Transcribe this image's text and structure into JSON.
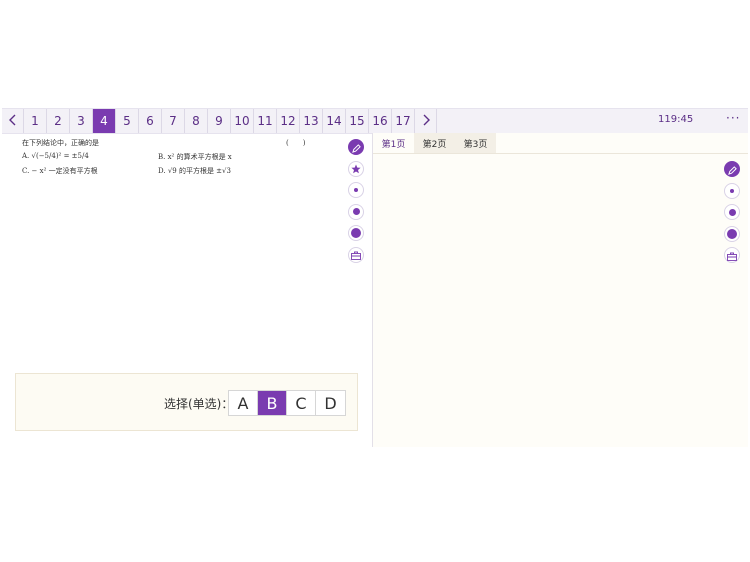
{
  "nav": {
    "prev_label": "<",
    "next_label": ">",
    "questions": [
      "1",
      "2",
      "3",
      "4",
      "5",
      "6",
      "7",
      "8",
      "9",
      "10",
      "11",
      "12",
      "13",
      "14",
      "15",
      "16",
      "17"
    ],
    "active_index": 3,
    "timer": "119:45",
    "more_label": "···"
  },
  "question": {
    "stem": "在下列结论中，正确的是",
    "paren": "(　　)",
    "option_a": "A. √(−5/4)² = ±5/4",
    "option_b": "B. x² 的算术平方根是 x",
    "option_c": "C. − x² 一定没有平方根",
    "option_d": "D. √9 的平方根是 ±√3"
  },
  "tools_left": [
    "pen-icon",
    "star-icon",
    "dot-small-icon",
    "dot-medium-icon",
    "dot-large-icon",
    "toolbox-icon"
  ],
  "tools_right": [
    "pen-icon",
    "dot-small-icon",
    "dot-medium-icon",
    "dot-large-icon",
    "toolbox-icon"
  ],
  "answer": {
    "label": "选择(单选)：",
    "choices": [
      "A",
      "B",
      "C",
      "D"
    ],
    "selected": "B"
  },
  "scratch": {
    "tabs": [
      "第1页",
      "第2页",
      "第3页"
    ],
    "active_tab": 0
  },
  "colors": {
    "accent": "#7a3bb0",
    "text_accent": "#5b2e86",
    "panel_bg": "#fdfbf3"
  }
}
